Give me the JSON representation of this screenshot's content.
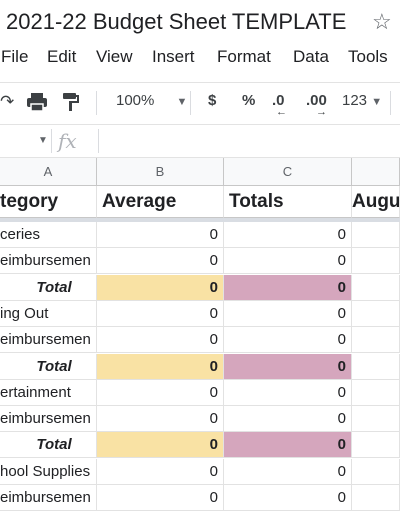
{
  "doc": {
    "title": "2021-22 Budget Sheet TEMPLATE",
    "star_icon": "star-outline"
  },
  "menu": [
    "File",
    "Edit",
    "View",
    "Insert",
    "Format",
    "Data",
    "Tools"
  ],
  "toolbar": {
    "zoom": "100%",
    "currency": "$",
    "percent": "%",
    "decrease_decimal": ".0",
    "increase_decimal": ".00",
    "more_formats": "123"
  },
  "formula_bar": {
    "fx": "fx",
    "value": ""
  },
  "columns": [
    {
      "letter": "A",
      "header": "tegory"
    },
    {
      "letter": "B",
      "header": "Average"
    },
    {
      "letter": "C",
      "header": "Totals"
    },
    {
      "letter": "",
      "header": "Augu"
    }
  ],
  "rows": [
    {
      "label": "ceries",
      "b": "0",
      "c": "0",
      "type": "item"
    },
    {
      "label": "eimbursemen",
      "b": "0",
      "c": "0",
      "type": "item"
    },
    {
      "label": "Total",
      "b": "0",
      "c": "0",
      "type": "total"
    },
    {
      "label": "ing Out",
      "b": "0",
      "c": "0",
      "type": "item"
    },
    {
      "label": "eimbursemen",
      "b": "0",
      "c": "0",
      "type": "item"
    },
    {
      "label": "Total",
      "b": "0",
      "c": "0",
      "type": "total"
    },
    {
      "label": "ertainment",
      "b": "0",
      "c": "0",
      "type": "item"
    },
    {
      "label": "eimbursemen",
      "b": "0",
      "c": "0",
      "type": "item"
    },
    {
      "label": "Total",
      "b": "0",
      "c": "0",
      "type": "total"
    },
    {
      "label": "hool Supplies",
      "b": "0",
      "c": "0",
      "type": "item"
    },
    {
      "label": "eimbursemen",
      "b": "0",
      "c": "0",
      "type": "item"
    }
  ],
  "colors": {
    "total_average": "#f9e2a4",
    "total_totals": "#d5a6bd"
  }
}
